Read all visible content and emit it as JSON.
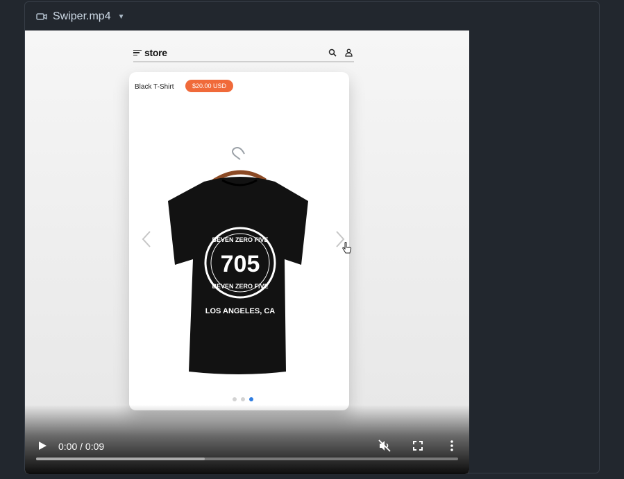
{
  "file": {
    "name": "Swiper.mp4",
    "icon": "video-icon"
  },
  "store": {
    "brand": "store",
    "icons": [
      "menu-icon",
      "search-icon",
      "user-icon"
    ]
  },
  "product": {
    "name": "Black T-Shirt",
    "price": "$20.00 USD"
  },
  "shirt_print": {
    "line1": "BEVEN ZERO FIVE",
    "number": "705",
    "line2": "BEVEN ZERO FIVE",
    "city": "LOS ANGELES, CA"
  },
  "carousel": {
    "slides": 3,
    "active_index": 2
  },
  "player": {
    "time": "0:00 / 0:09",
    "progress_fraction": 0.4,
    "muted": true
  },
  "colors": {
    "accent_badge": "#f06a3a",
    "active_dot": "#2f7de1",
    "bg": "#22272e"
  }
}
